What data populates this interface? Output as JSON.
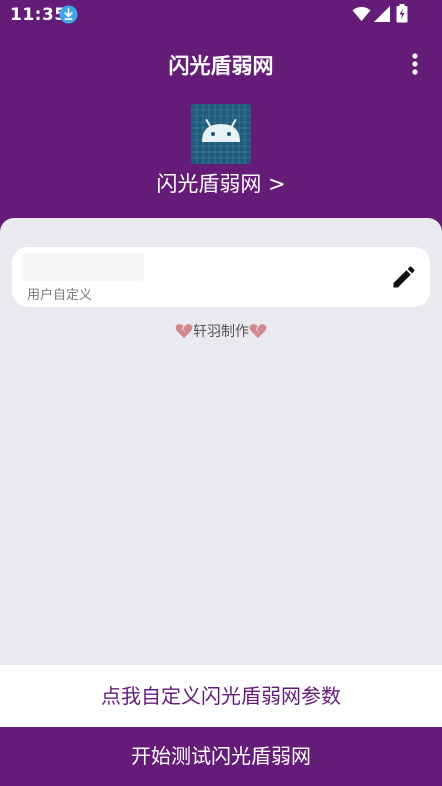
{
  "status_bar": {
    "time": "11:35",
    "icons": [
      "download-icon",
      "wifi-icon",
      "signal-icon",
      "battery-icon"
    ]
  },
  "app_bar": {
    "title": "闪光盾弱网",
    "menu_icon": "more-vert-icon"
  },
  "header": {
    "icon": "android-icon",
    "app_name": "闪光盾弱网 >"
  },
  "input": {
    "label": "用户自定义",
    "value": "",
    "edit_icon": "pencil-icon"
  },
  "credit": {
    "text": "轩羽制作",
    "icon": "broken-heart-icon"
  },
  "buttons": {
    "customize_label": "点我自定义闪光盾弱网参数",
    "start_label": "开始测试闪光盾弱网"
  },
  "colors": {
    "primary": "#641c78",
    "background": "#e9e9ef",
    "card": "#ffffff",
    "icon_bg": "#1f5b7a",
    "android_green": "#e9f2f7",
    "heart": "#d4868f",
    "download_badge": "#3fa7e8"
  }
}
